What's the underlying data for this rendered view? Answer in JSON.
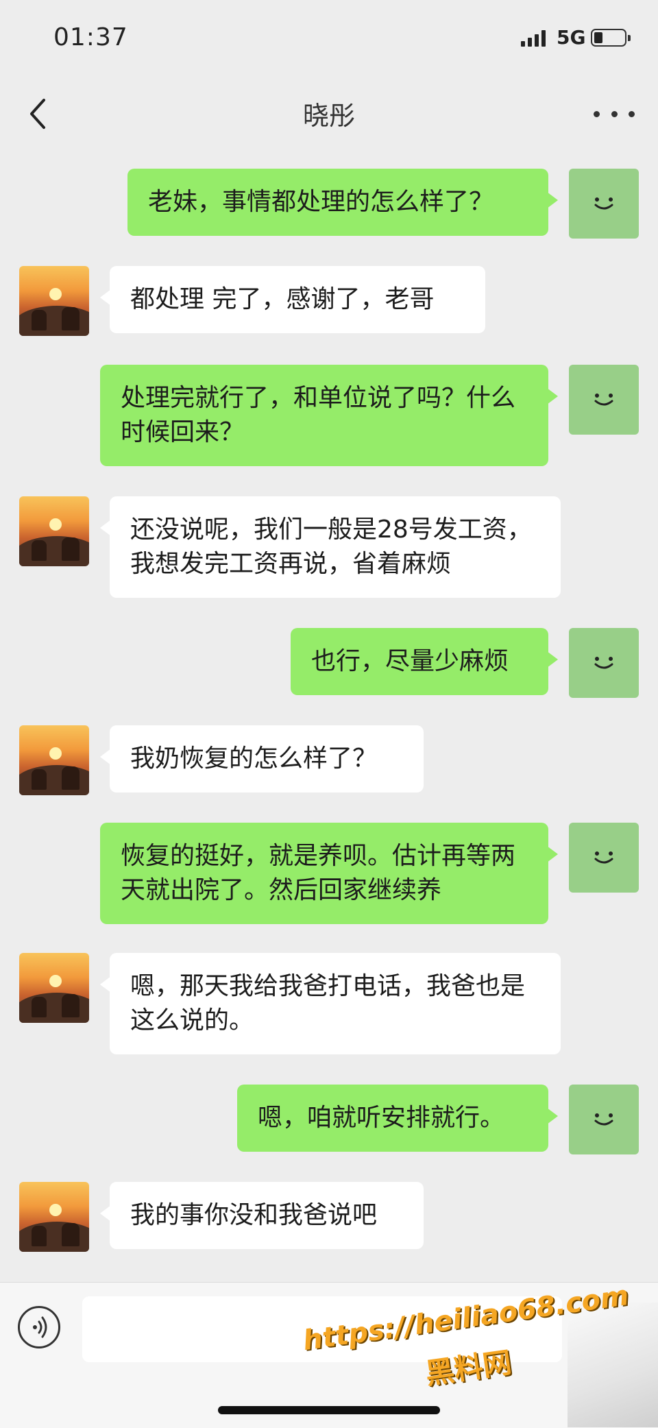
{
  "status": {
    "time": "01:37",
    "network": "5G"
  },
  "header": {
    "contact_name": "晓彤"
  },
  "messages": [
    {
      "from": "me",
      "text": "老妹，事情都处理的怎么样了？"
    },
    {
      "from": "other",
      "text": "都处理 完了，感谢了，老哥"
    },
    {
      "from": "me",
      "text": "处理完就行了，和单位说了吗？什么时候回来？"
    },
    {
      "from": "other",
      "text": "还没说呢，我们一般是28号发工资，我想发完工资再说，省着麻烦"
    },
    {
      "from": "me",
      "text": "也行，尽量少麻烦"
    },
    {
      "from": "other",
      "text": "我奶恢复的怎么样了？"
    },
    {
      "from": "me",
      "text": "恢复的挺好，就是养呗。估计再等两天就出院了。然后回家继续养"
    },
    {
      "from": "other",
      "text": "嗯，那天我给我爸打电话，我爸也是这么说的。"
    },
    {
      "from": "me",
      "text": "嗯，咱就听安排就行。"
    },
    {
      "from": "other",
      "text": "我的事你没和我爸说吧"
    }
  ],
  "watermark": {
    "url": "https://heiliao68.com",
    "name": "黑料网"
  },
  "colors": {
    "me_bubble": "#95ec69",
    "me_avatar": "#98cf88",
    "background": "#ededed"
  },
  "icons": {
    "back": "chevron-left-icon",
    "more": "more-dots-icon",
    "voice": "voice-icon",
    "me_avatar": "smile-icon"
  }
}
